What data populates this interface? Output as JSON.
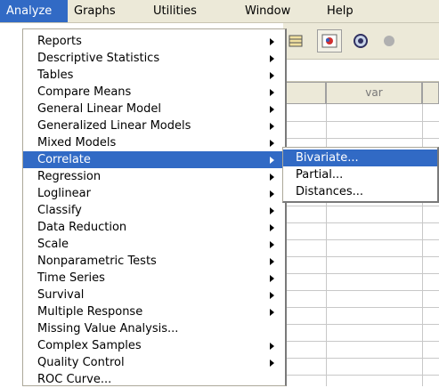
{
  "menubar": {
    "items": [
      {
        "label": "Analyze",
        "active": true
      },
      {
        "label": "Graphs",
        "active": false
      },
      {
        "label": "Utilities",
        "active": false
      },
      {
        "label": "Window",
        "active": false
      },
      {
        "label": "Help",
        "active": false
      }
    ]
  },
  "grid": {
    "col_header": "var"
  },
  "analyze_menu": {
    "items": [
      {
        "label": "Reports",
        "submenu": true
      },
      {
        "label": "Descriptive Statistics",
        "submenu": true
      },
      {
        "label": "Tables",
        "submenu": true
      },
      {
        "label": "Compare Means",
        "submenu": true
      },
      {
        "label": "General Linear Model",
        "submenu": true
      },
      {
        "label": "Generalized Linear Models",
        "submenu": true
      },
      {
        "label": "Mixed Models",
        "submenu": true
      },
      {
        "label": "Correlate",
        "submenu": true,
        "highlighted": true
      },
      {
        "label": "Regression",
        "submenu": true
      },
      {
        "label": "Loglinear",
        "submenu": true
      },
      {
        "label": "Classify",
        "submenu": true
      },
      {
        "label": "Data Reduction",
        "submenu": true
      },
      {
        "label": "Scale",
        "submenu": true
      },
      {
        "label": "Nonparametric Tests",
        "submenu": true
      },
      {
        "label": "Time Series",
        "submenu": true
      },
      {
        "label": "Survival",
        "submenu": true
      },
      {
        "label": "Multiple Response",
        "submenu": true
      },
      {
        "label": "Missing Value Analysis...",
        "submenu": false
      },
      {
        "label": "Complex Samples",
        "submenu": true
      },
      {
        "label": "Quality Control",
        "submenu": true
      },
      {
        "label": "ROC Curve...",
        "submenu": false
      }
    ]
  },
  "correlate_submenu": {
    "items": [
      {
        "label": "Bivariate...",
        "highlighted": true
      },
      {
        "label": "Partial...",
        "highlighted": false
      },
      {
        "label": "Distances...",
        "highlighted": false
      }
    ]
  },
  "colors": {
    "highlight": "#316ac5",
    "menubar_bg": "#ece9d8"
  },
  "toolbar_icons": [
    "grid-icon",
    "chart-icon",
    "scope-icon",
    "circle-icon"
  ]
}
